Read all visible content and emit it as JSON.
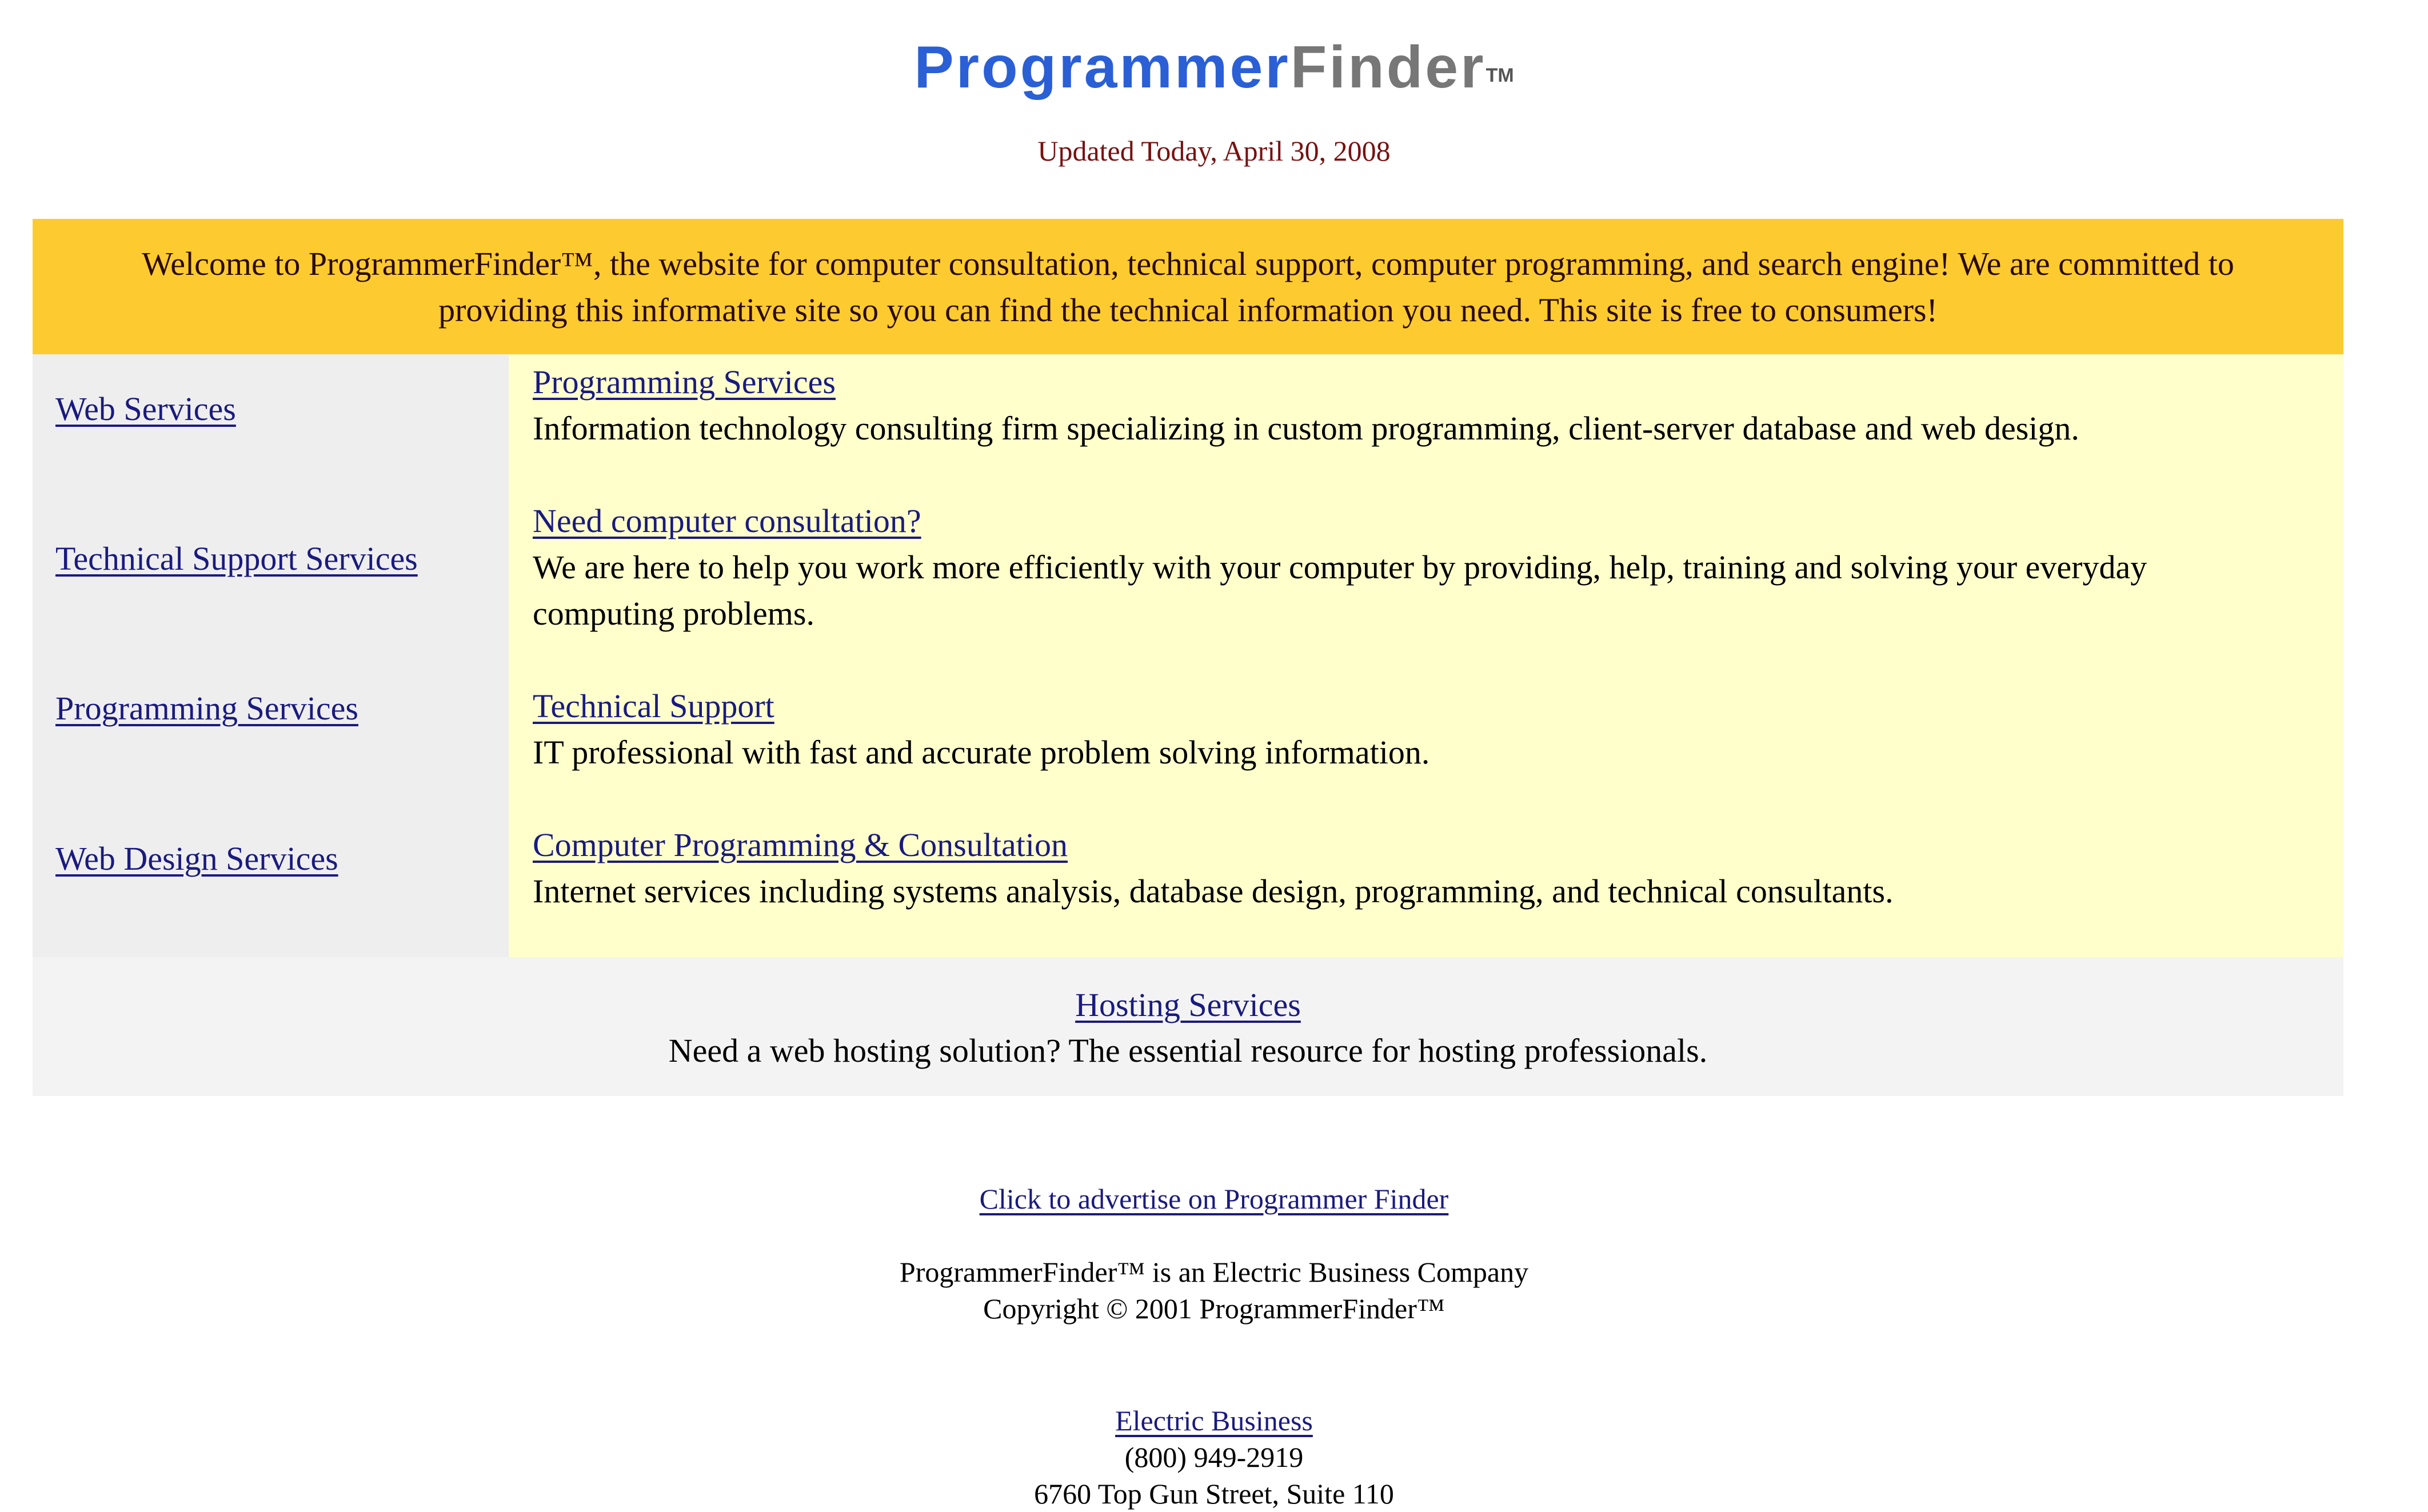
{
  "header": {
    "logo_part1": "Programmer",
    "logo_part2": "Finder",
    "logo_tm": "TM",
    "updated": "Updated Today, April 30, 2008"
  },
  "colors": {
    "logo_blue": "#2a5fd6",
    "logo_gray": "#777777",
    "banner_bg": "#fdcb2f",
    "left_column_bg": "#eeeeee",
    "right_column_bg": "#ffffcc",
    "hosting_bg": "#f3f3f3",
    "link": "#1a1a80",
    "updated_text": "#7a1010"
  },
  "banner": {
    "text": "Welcome to ProgrammerFinder™, the website for computer consultation, technical support, computer programming, and search engine! We are committed to providing this informative site so you can find the technical information you need. This site is free to consumers!"
  },
  "sidebar": {
    "links": [
      {
        "label": "Web Services"
      },
      {
        "label": "Technical Support Services"
      },
      {
        "label": "Programming Services"
      },
      {
        "label": "Web Design Services"
      }
    ]
  },
  "listings": [
    {
      "title": "Programming Services",
      "description": "Information technology consulting firm specializing in custom programming, client-server database and web design."
    },
    {
      "title": "Need computer consultation?",
      "description": "We are here to help you work more efficiently with your computer by providing, help, training and solving your everyday computing problems."
    },
    {
      "title": "Technical Support",
      "description": "IT professional with fast and accurate problem solving information."
    },
    {
      "title": "Computer Programming & Consultation",
      "description": "Internet services including systems analysis, database design, programming, and technical consultants."
    }
  ],
  "hosting": {
    "title": "Hosting Services",
    "description": "Need a web hosting solution? The essential resource for hosting professionals."
  },
  "footer": {
    "advertise_link": "Click to advertise on Programmer Finder",
    "company_line": "ProgrammerFinder™ is an Electric Business Company",
    "copyright": "Copyright © 2001 ProgrammerFinder™",
    "company_link": "Electric Business",
    "phone": "(800) 949-2919",
    "address": "6760 Top Gun Street, Suite 110"
  }
}
